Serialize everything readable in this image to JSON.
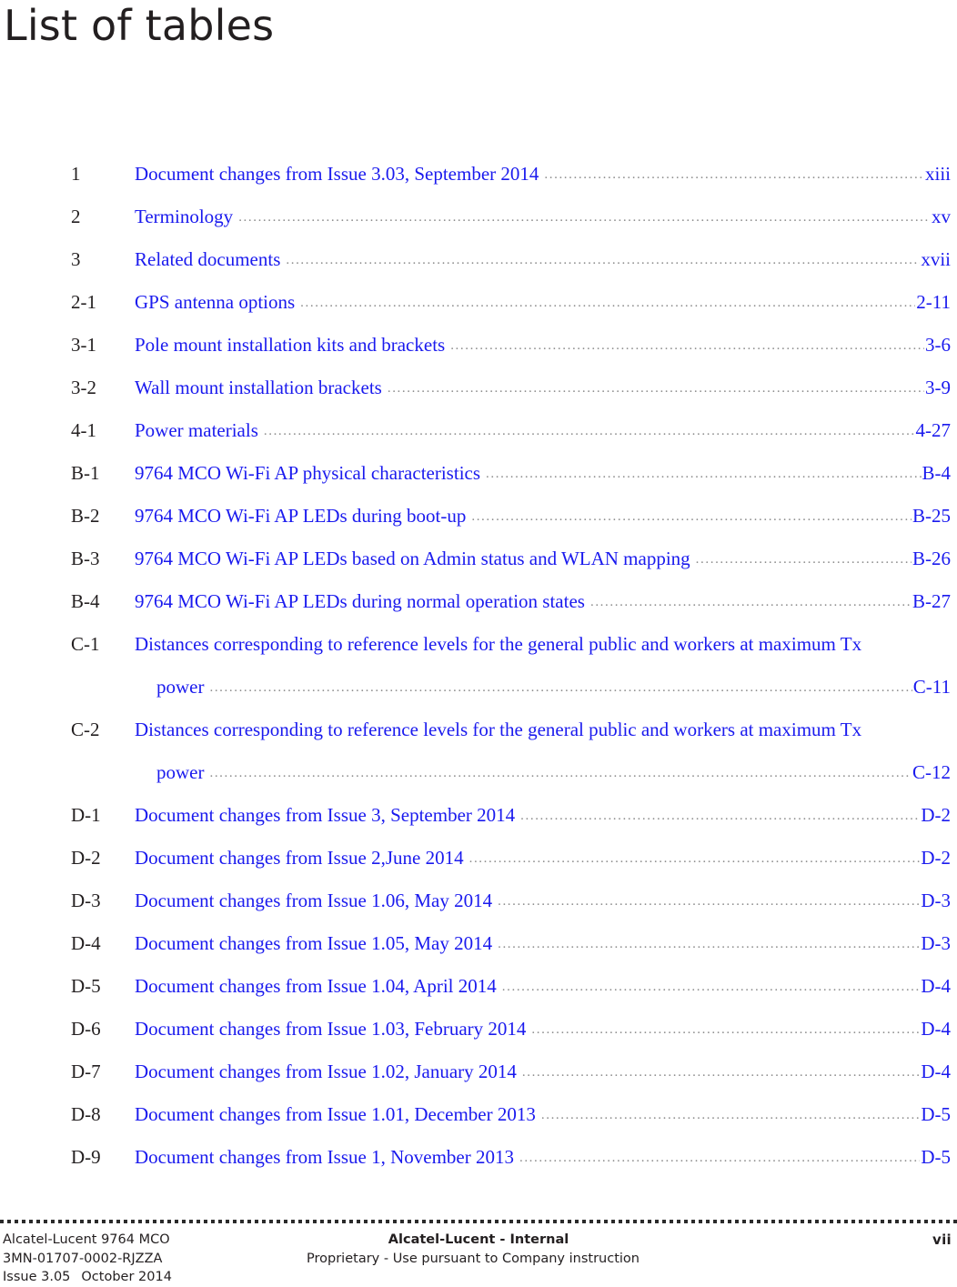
{
  "page": {
    "title": "List of tables"
  },
  "entries": [
    {
      "number": "1",
      "title": "Document changes from Issue 3.03, September 2014",
      "page": "xiii",
      "wrap": null
    },
    {
      "number": "2",
      "title": "Terminology",
      "page": "xv",
      "wrap": null
    },
    {
      "number": "3",
      "title": "Related documents",
      "page": "xvii",
      "wrap": null
    },
    {
      "number": "2-1",
      "title": "GPS antenna options",
      "page": "2-11",
      "wrap": null
    },
    {
      "number": "3-1",
      "title": "Pole mount installation kits and brackets",
      "page": "3-6",
      "wrap": null
    },
    {
      "number": "3-2",
      "title": "Wall mount installation brackets",
      "page": "3-9",
      "wrap": null
    },
    {
      "number": "4-1",
      "title": "Power materials",
      "page": "4-27",
      "wrap": null
    },
    {
      "number": "B-1",
      "title": "9764 MCO Wi-Fi AP physical characteristics",
      "page": "B-4",
      "wrap": null
    },
    {
      "number": "B-2",
      "title": "9764 MCO Wi-Fi AP LEDs during boot-up",
      "page": "B-25",
      "wrap": null
    },
    {
      "number": "B-3",
      "title": "9764 MCO Wi-Fi AP LEDs based on Admin status and WLAN mapping",
      "page": "B-26",
      "wrap": null
    },
    {
      "number": "B-4",
      "title": "9764 MCO Wi-Fi AP LEDs during normal operation states",
      "page": "B-27",
      "wrap": null
    },
    {
      "number": "C-1",
      "title": "power",
      "page": "C-11",
      "wrap": "Distances corresponding to reference levels for the general public and workers at maximum Tx"
    },
    {
      "number": "C-2",
      "title": "power",
      "page": "C-12",
      "wrap": "Distances corresponding to reference levels for the general public and workers at maximum Tx"
    },
    {
      "number": "D-1",
      "title": "Document changes from Issue 3, September 2014",
      "page": "D-2",
      "wrap": null
    },
    {
      "number": "D-2",
      "title": "Document changes from Issue 2,June 2014",
      "page": "D-2",
      "wrap": null
    },
    {
      "number": "D-3",
      "title": "Document changes from Issue 1.06, May 2014",
      "page": "D-3",
      "wrap": null
    },
    {
      "number": "D-4",
      "title": "Document changes from Issue 1.05, May 2014",
      "page": "D-3",
      "wrap": null
    },
    {
      "number": "D-5",
      "title": "Document changes from Issue 1.04, April 2014",
      "page": "D-4",
      "wrap": null
    },
    {
      "number": "D-6",
      "title": "Document changes from Issue 1.03, February 2014",
      "page": "D-4",
      "wrap": null
    },
    {
      "number": "D-7",
      "title": "Document changes from Issue 1.02, January 2014",
      "page": "D-4",
      "wrap": null
    },
    {
      "number": "D-8",
      "title": "Document changes from Issue 1.01, December 2013",
      "page": "D-5",
      "wrap": null
    },
    {
      "number": "D-9",
      "title": "Document changes from Issue 1, November 2013",
      "page": "D-5",
      "wrap": null
    }
  ],
  "footer": {
    "left": {
      "product": "Alcatel-Lucent 9764 MCO",
      "doc_number": "3MN-01707-0002-RJZZA",
      "issue": "Issue 3.05",
      "date": "October 2014"
    },
    "center": {
      "classification": "Alcatel-Lucent - Internal",
      "notice": "Proprietary - Use pursuant to Company instruction"
    },
    "page_number": "vii"
  },
  "colors": {
    "link_blue": "#1a1aee",
    "text_black": "#231f20",
    "leader_gray": "#8d8d8d"
  }
}
